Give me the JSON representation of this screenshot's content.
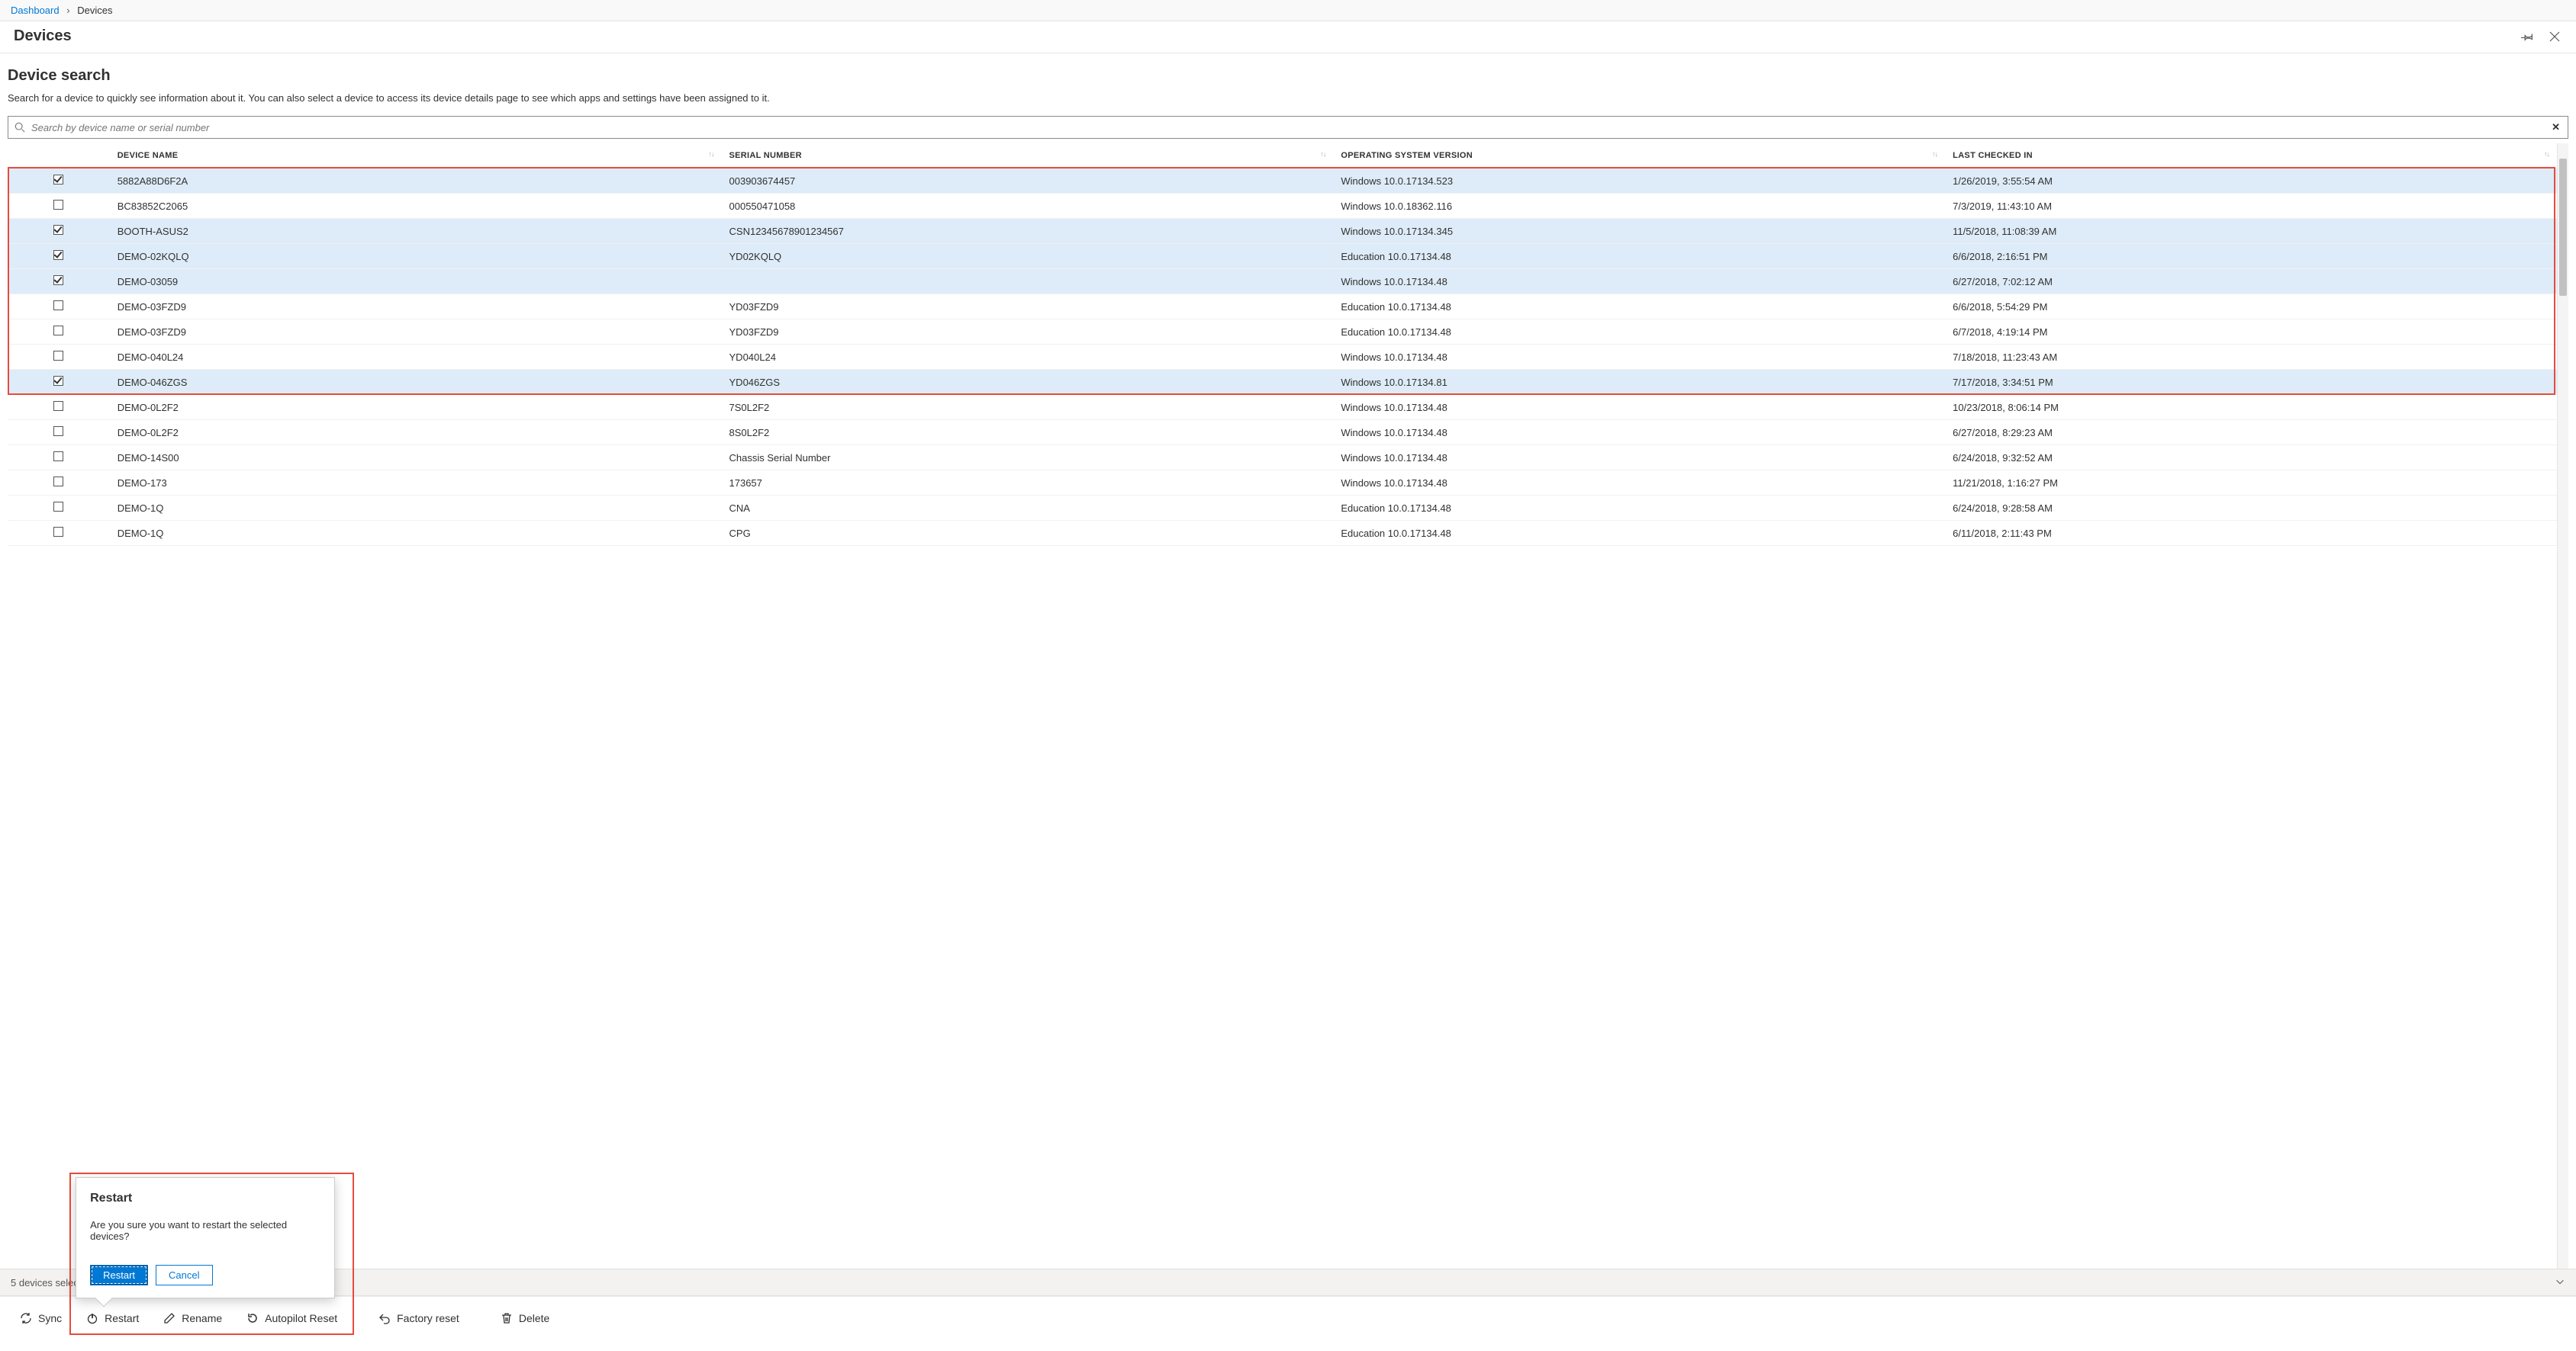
{
  "breadcrumb": {
    "root": "Dashboard",
    "current": "Devices"
  },
  "page": {
    "title": "Devices"
  },
  "section": {
    "heading": "Device search",
    "description": "Search for a device to quickly see information about it. You can also select a device to access its device details page to see which apps and settings have been assigned to it."
  },
  "search": {
    "placeholder": "Search by device name or serial number"
  },
  "columns": {
    "name": "DEVICE NAME",
    "serial": "SERIAL NUMBER",
    "os": "OPERATING SYSTEM VERSION",
    "checked": "LAST CHECKED IN"
  },
  "rows": [
    {
      "selected": true,
      "name": "5882A88D6F2A",
      "serial": "003903674457",
      "os": "Windows 10.0.17134.523",
      "checked": "1/26/2019, 3:55:54 AM"
    },
    {
      "selected": false,
      "name": "BC83852C2065",
      "serial": "000550471058",
      "os": "Windows 10.0.18362.116",
      "checked": "7/3/2019, 11:43:10 AM"
    },
    {
      "selected": true,
      "name": "BOOTH-ASUS2",
      "serial": "CSN12345678901234567",
      "os": "Windows 10.0.17134.345",
      "checked": "11/5/2018, 11:08:39 AM"
    },
    {
      "selected": true,
      "name": "DEMO-02KQLQ",
      "serial": "YD02KQLQ",
      "os": "Education 10.0.17134.48",
      "checked": "6/6/2018, 2:16:51 PM"
    },
    {
      "selected": true,
      "name": "DEMO-03059",
      "serial": "",
      "os": "Windows 10.0.17134.48",
      "checked": "6/27/2018, 7:02:12 AM"
    },
    {
      "selected": false,
      "name": "DEMO-03FZD9",
      "serial": "YD03FZD9",
      "os": "Education 10.0.17134.48",
      "checked": "6/6/2018, 5:54:29 PM"
    },
    {
      "selected": false,
      "name": "DEMO-03FZD9",
      "serial": "YD03FZD9",
      "os": "Education 10.0.17134.48",
      "checked": "6/7/2018, 4:19:14 PM"
    },
    {
      "selected": false,
      "name": "DEMO-040L24",
      "serial": "YD040L24",
      "os": "Windows 10.0.17134.48",
      "checked": "7/18/2018, 11:23:43 AM"
    },
    {
      "selected": true,
      "name": "DEMO-046ZGS",
      "serial": "YD046ZGS",
      "os": "Windows 10.0.17134.81",
      "checked": "7/17/2018, 3:34:51 PM"
    },
    {
      "selected": false,
      "name": "DEMO-0L2F2",
      "serial": "7S0L2F2",
      "os": "Windows 10.0.17134.48",
      "checked": "10/23/2018, 8:06:14 PM"
    },
    {
      "selected": false,
      "name": "DEMO-0L2F2",
      "serial": "8S0L2F2",
      "os": "Windows 10.0.17134.48",
      "checked": "6/27/2018, 8:29:23 AM"
    },
    {
      "selected": false,
      "name": "DEMO-14S00",
      "serial": "Chassis Serial Number",
      "os": "Windows 10.0.17134.48",
      "checked": "6/24/2018, 9:32:52 AM"
    },
    {
      "selected": false,
      "name": "DEMO-173",
      "serial": "173657",
      "os": "Windows 10.0.17134.48",
      "checked": "11/21/2018, 1:16:27 PM"
    },
    {
      "selected": false,
      "name": "DEMO-1Q",
      "serial": "CNA",
      "os": "Education 10.0.17134.48",
      "checked": "6/24/2018, 9:28:58 AM"
    },
    {
      "selected": false,
      "name": "DEMO-1Q",
      "serial": "CPG",
      "os": "Education 10.0.17134.48",
      "checked": "6/11/2018, 2:11:43 PM"
    }
  ],
  "selection_bar": {
    "text": "5 devices selected"
  },
  "actions": {
    "sync": "Sync",
    "restart": "Restart",
    "rename": "Rename",
    "autopilot": "Autopilot Reset",
    "factory": "Factory reset",
    "delete": "Delete"
  },
  "dialog": {
    "title": "Restart",
    "message": "Are you sure you want to restart the selected devices?",
    "confirm": "Restart",
    "cancel": "Cancel"
  }
}
